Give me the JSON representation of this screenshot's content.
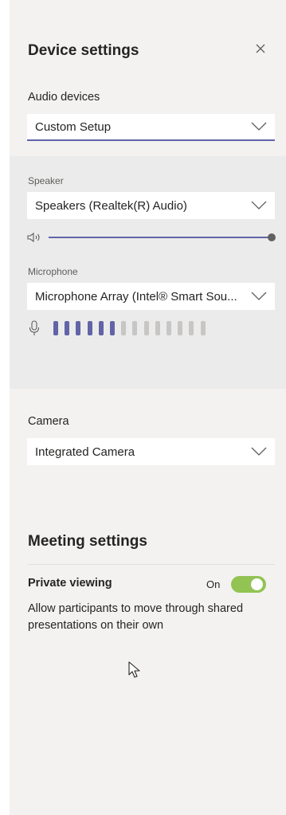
{
  "panel": {
    "title": "Device settings",
    "close_icon": "close-icon"
  },
  "audio": {
    "section_label": "Audio devices",
    "selected": "Custom Setup",
    "speaker": {
      "label": "Speaker",
      "selected": "Speakers (Realtek(R) Audio)",
      "volume_level": 1.0
    },
    "microphone": {
      "label": "Microphone",
      "selected": "Microphone Array (Intel® Smart Sou...",
      "level_bars_total": 14,
      "level_bars_active": 6
    }
  },
  "camera": {
    "label": "Camera",
    "selected": "Integrated Camera"
  },
  "meeting": {
    "heading": "Meeting settings",
    "private_viewing": {
      "label": "Private viewing",
      "state_text": "On",
      "enabled": true,
      "description": "Allow participants to move through shared presentations on their own"
    }
  },
  "colors": {
    "accent": "#6264a7",
    "toggle_on": "#92c353",
    "panel_bg": "#f3f2f1",
    "audio_block_bg": "#ebebeb",
    "bar_inactive": "#c8c6c4"
  }
}
